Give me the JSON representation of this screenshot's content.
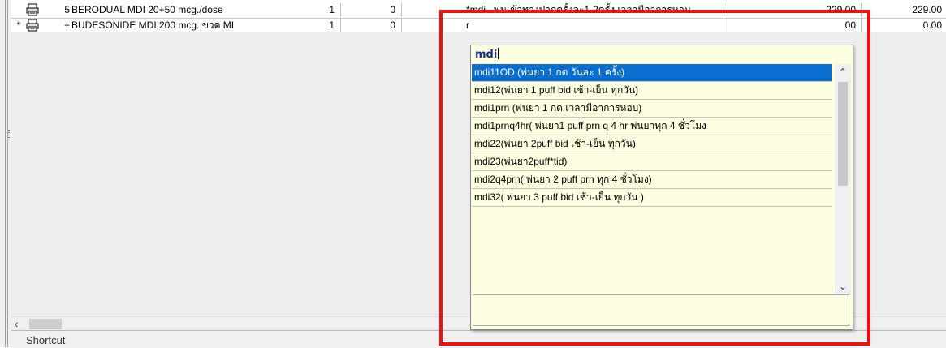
{
  "rows": [
    {
      "indicator": "",
      "number": "5",
      "drug": "BERODUAL MDI 20+50 mcg./dose ",
      "qty1": "1",
      "qty2": "0",
      "usage": "*mdi...พ่นเข้าทางปากครั้งละ1-2ครั้ง เวลามีอาการหอบ",
      "price": "229.00",
      "total": "229.00"
    },
    {
      "indicator": "*",
      "number": "+",
      "drug": "BUDESONIDE MDI 200 mcg. ขวด MI",
      "qty1": "1",
      "qty2": "0",
      "usage": "r",
      "price": "00",
      "total": "0.00"
    }
  ],
  "dropdown": {
    "search_text": "mdi",
    "items": [
      "mdi11OD (พ่นยา 1 กด วันละ 1 ครั้ง)",
      "mdi12(พ่นยา 1 puff bid  เช้า-เย็น ทุกวัน)",
      "mdi1prn (พ่นยา 1 กด เวลามีอาการหอบ)",
      "mdi1prnq4hr( พ่นยา1 puff prn q 4 hr  พ่นยาทุก 4 ชั่วโมง",
      "mdi22(พ่นยา 2puff bid เช้า-เย็น ทุกวัน)",
      "mdi23(พ่นยา2puff*tid)",
      "mdi2q4prn( พ่นยา 2 puff prn ทุก 4 ชั่วโมง)",
      "mdi32( พ่นยา 3 puff bid  เช้า-เย็น ทุกวัน )"
    ],
    "selected_index": 0
  },
  "status": {
    "shortcut_label": "Shortcut"
  },
  "colors": {
    "highlight": "#ee1111",
    "selection": "#0a6ed1",
    "dropdown_bg": "#fdfde0"
  },
  "icons": {
    "row_icon": "printer-icon",
    "scroll_left": "chevron-left-icon",
    "scroll_up": "chevron-up-icon",
    "scroll_down": "chevron-down-icon"
  }
}
